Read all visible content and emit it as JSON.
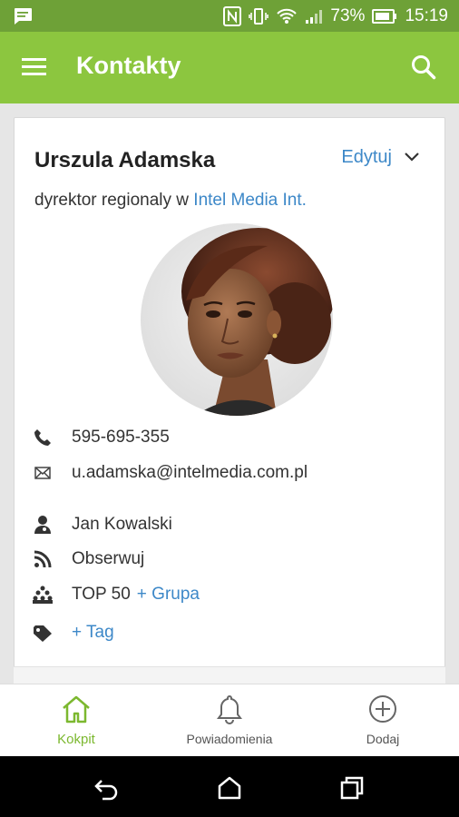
{
  "status_bar": {
    "battery": "73%",
    "time": "15:19",
    "icons": [
      "message-icon",
      "nfc-icon",
      "vibrate-icon",
      "wifi-icon",
      "signal-icon",
      "battery-icon"
    ]
  },
  "app_bar": {
    "title": "Kontakty",
    "icons": [
      "menu-icon",
      "search-icon"
    ]
  },
  "contact": {
    "name": "Urszula Adamska",
    "edit_label": "Edytuj",
    "role_prefix": "dyrektor regionaly w ",
    "company": "Intel Media Int.",
    "phone": "595-695-355",
    "email": "u.adamska@intelmedia.com.pl",
    "owner": "Jan Kowalski",
    "follow": "Obserwuj",
    "group": "TOP 50",
    "add_group": "+ Grupa",
    "add_tag": "+ Tag"
  },
  "bottom_nav": {
    "items": [
      {
        "label": "Kokpit",
        "icon": "home-icon",
        "active": true
      },
      {
        "label": "Powiadomienia",
        "icon": "bell-icon",
        "active": false
      },
      {
        "label": "Dodaj",
        "icon": "plus-circle-icon",
        "active": false
      }
    ]
  },
  "colors": {
    "status_bar": "#6ea137",
    "app_bar": "#8cc63f",
    "link": "#3d88c8",
    "active_nav": "#7cb82f"
  }
}
